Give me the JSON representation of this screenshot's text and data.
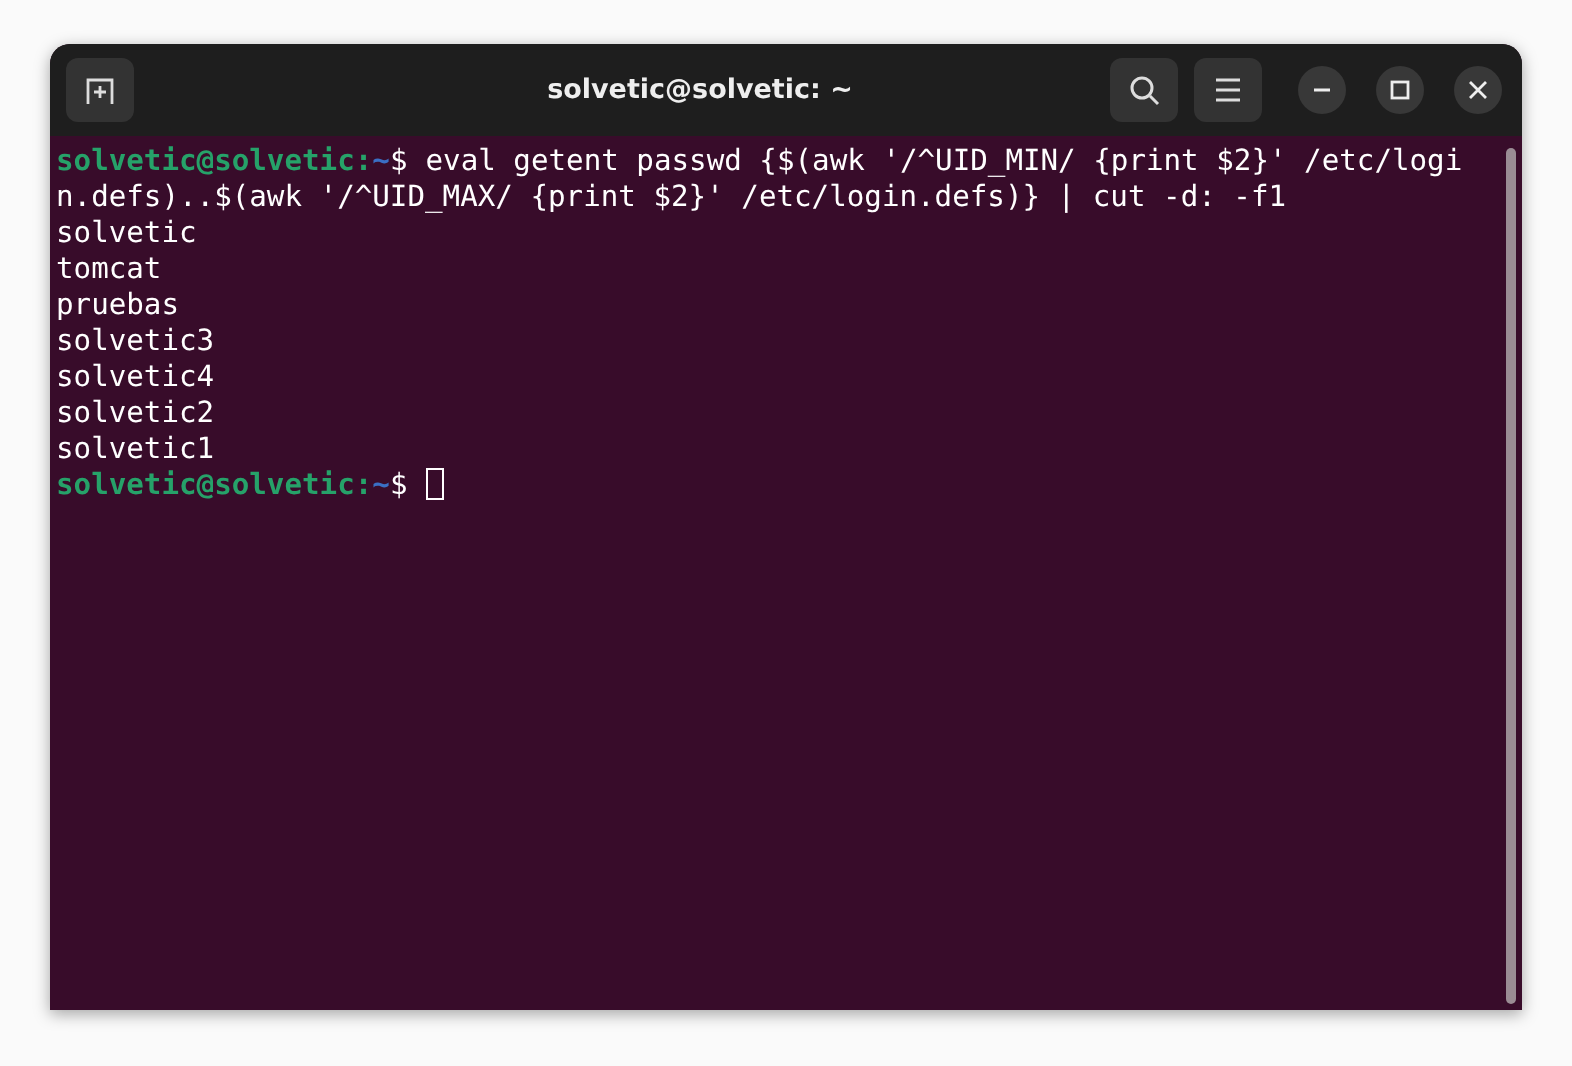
{
  "window": {
    "title": "solvetic@solvetic: ~"
  },
  "terminal": {
    "lines": [
      {
        "kind": "prompt",
        "user": "solvetic@solvetic:",
        "path": "~",
        "symbol": "$",
        "command": "eval getent passwd {$(awk '/^UID_MIN/ {print $2}' /etc/logi",
        "cursor": false
      },
      {
        "kind": "output",
        "text": "n.defs)..$(awk '/^UID_MAX/ {print $2}' /etc/login.defs)} | cut -d: -f1"
      },
      {
        "kind": "output",
        "text": "solvetic"
      },
      {
        "kind": "output",
        "text": "tomcat"
      },
      {
        "kind": "output",
        "text": "pruebas"
      },
      {
        "kind": "output",
        "text": "solvetic3"
      },
      {
        "kind": "output",
        "text": "solvetic4"
      },
      {
        "kind": "output",
        "text": "solvetic2"
      },
      {
        "kind": "output",
        "text": "solvetic1"
      },
      {
        "kind": "prompt",
        "user": "solvetic@solvetic:",
        "path": "~",
        "symbol": "$",
        "cursor": true
      }
    ]
  }
}
